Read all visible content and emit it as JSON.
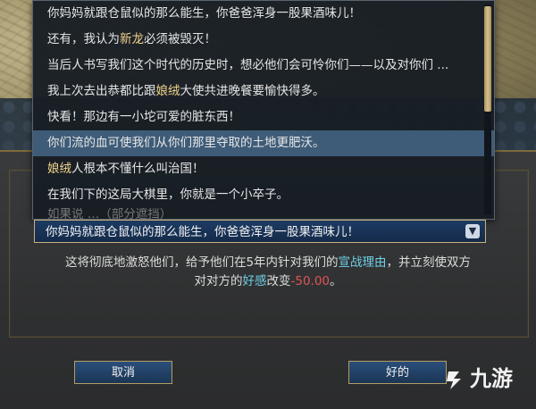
{
  "dropdown": {
    "options": [
      {
        "parts": [
          {
            "t": "你妈妈就跟仓鼠似的那么能生，你爸爸浑身一股果酒味儿！",
            "c": ""
          }
        ]
      },
      {
        "parts": [
          {
            "t": "还有，我认为",
            "c": ""
          },
          {
            "t": "新龙",
            "c": "gold"
          },
          {
            "t": "必须被毁灭！",
            "c": ""
          }
        ]
      },
      {
        "parts": [
          {
            "t": "当后人书写我们这个时代的历史时，想必他们会可怜你们——以及对你们 ...",
            "c": ""
          }
        ]
      },
      {
        "parts": [
          {
            "t": "我上次去出恭都比跟",
            "c": ""
          },
          {
            "t": "娘绒",
            "c": "gold"
          },
          {
            "t": "大使共进晚餐要愉快得多。",
            "c": ""
          }
        ]
      },
      {
        "parts": [
          {
            "t": "快看！那边有一小坨可爱的脏东西！",
            "c": ""
          }
        ]
      },
      {
        "parts": [
          {
            "t": "你们流的血可使我们从你们那里夺取的土地更肥沃。",
            "c": ""
          }
        ],
        "highlight": true
      },
      {
        "parts": [
          {
            "t": "娘绒",
            "c": "gold"
          },
          {
            "t": "人根本不懂什么叫治国！",
            "c": ""
          }
        ]
      },
      {
        "parts": [
          {
            "t": "在我们下的这局大棋里，你就是一个小卒子。",
            "c": ""
          }
        ]
      }
    ],
    "partial_text": "如果说 …（部分遮挡）"
  },
  "select": {
    "value": "你妈妈就跟仓鼠似的那么能生，你爸爸浑身一股果酒味儿！"
  },
  "description": {
    "line1_a": "这将彻底地激怒他们，给予他们在5年内针对我们的",
    "line1_b": "宣战理由",
    "line1_c": "，并立刻使双方",
    "line2_a": "对对方的",
    "line2_b": "好感",
    "line2_c": "改变",
    "line2_d": "-50.00",
    "line2_e": "。"
  },
  "buttons": {
    "cancel": "取消",
    "ok": "好的"
  },
  "watermark": {
    "text": "九游"
  },
  "colors": {
    "gold": "#f0d28c",
    "cyan": "#6fd0e8",
    "red": "#e05555",
    "highlight": "#3e5c78"
  }
}
